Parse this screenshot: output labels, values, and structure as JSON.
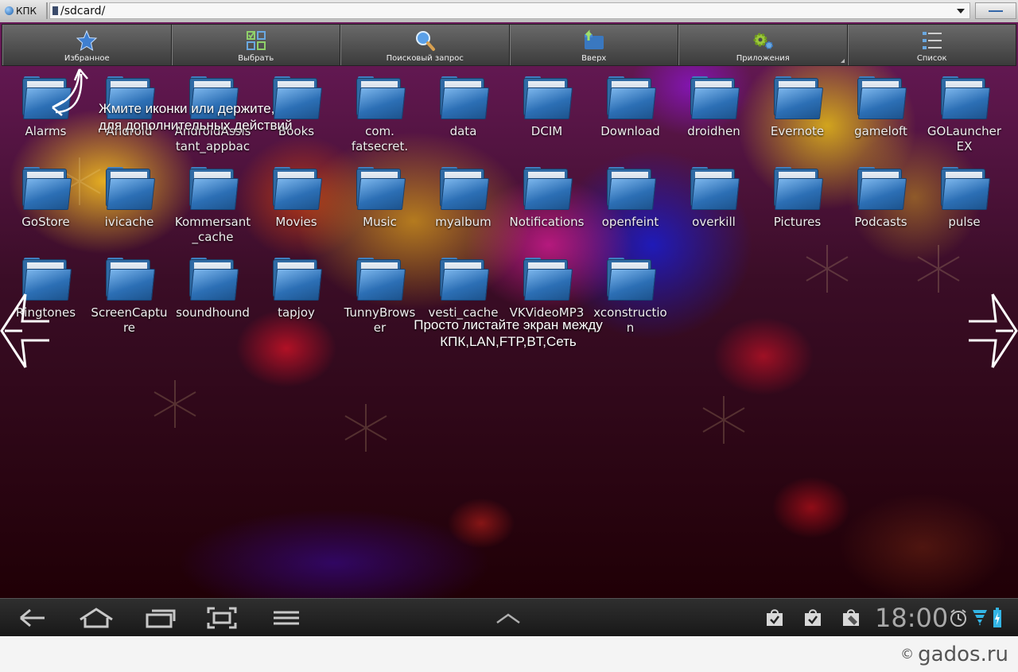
{
  "address_bar": {
    "location_label": "КПК",
    "path": "/sdcard/"
  },
  "toolbar": {
    "buttons": [
      {
        "label": "Избранное",
        "icon": "star-icon"
      },
      {
        "label": "Выбрать",
        "icon": "select-icon"
      },
      {
        "label": "Поисковый запрос",
        "icon": "search-icon"
      },
      {
        "label": "Вверх",
        "icon": "folder-up-icon"
      },
      {
        "label": "Приложения",
        "icon": "gears-icon"
      },
      {
        "label": "Список",
        "icon": "list-icon"
      }
    ]
  },
  "folders": [
    "Alarms",
    "Android",
    "AndroidAssistant_appbac",
    "Books",
    "com.fatsecret.",
    "data",
    "DCIM",
    "Download",
    "droidhen",
    "Evernote",
    "gameloft",
    "GOLauncherEX",
    "GoStore",
    "ivicache",
    "Kommersant_cache",
    "Movies",
    "Music",
    "myalbum",
    "Notifications",
    "openfeint",
    "overkill",
    "Pictures",
    "Podcasts",
    "pulse",
    "Ringtones",
    "ScreenCapture",
    "soundhound",
    "tapjoy",
    "TunnyBrowser",
    "vesti_cache",
    "VKVideoMP3",
    "xconstruction"
  ],
  "folder_display_names": [
    "Alarms",
    "Android",
    "AndroidAssis\ntant_appbac",
    "Books",
    "com.\nfatsecret.",
    "data",
    "DCIM",
    "Download",
    "droidhen",
    "Evernote",
    "gameloft",
    "GOLauncher\nEX",
    "GoStore",
    "ivicache",
    "Kommersant\n_cache",
    "Movies",
    "Music",
    "myalbum",
    "Notifications",
    "openfeint",
    "overkill",
    "Pictures",
    "Podcasts",
    "pulse",
    "Ringtones",
    "ScreenCaptu\nre",
    "soundhound",
    "tapjoy",
    "TunnyBrows\ner",
    "vesti_cache",
    "VKVideoMP3",
    "xconstructio\nn"
  ],
  "tips": {
    "icons_tip": "Жмите иконки или держите,\nдля дополнительных действий",
    "swipe_tip": "Просто листайте экран между\nКПК,LAN,FTP,BT,Сеть"
  },
  "system_bar": {
    "time": "18:00",
    "nav_icons": [
      "back-icon",
      "home-icon",
      "recent-apps-icon",
      "screenshot-icon",
      "menu-icon"
    ],
    "notification_icons": [
      "market-update-icon",
      "market-update-icon",
      "shopping-bag-icon"
    ],
    "status_icons": [
      "alarm-icon",
      "wifi-icon",
      "battery-icon"
    ]
  },
  "watermark": {
    "symbol": "©",
    "text": "gados.ru"
  }
}
